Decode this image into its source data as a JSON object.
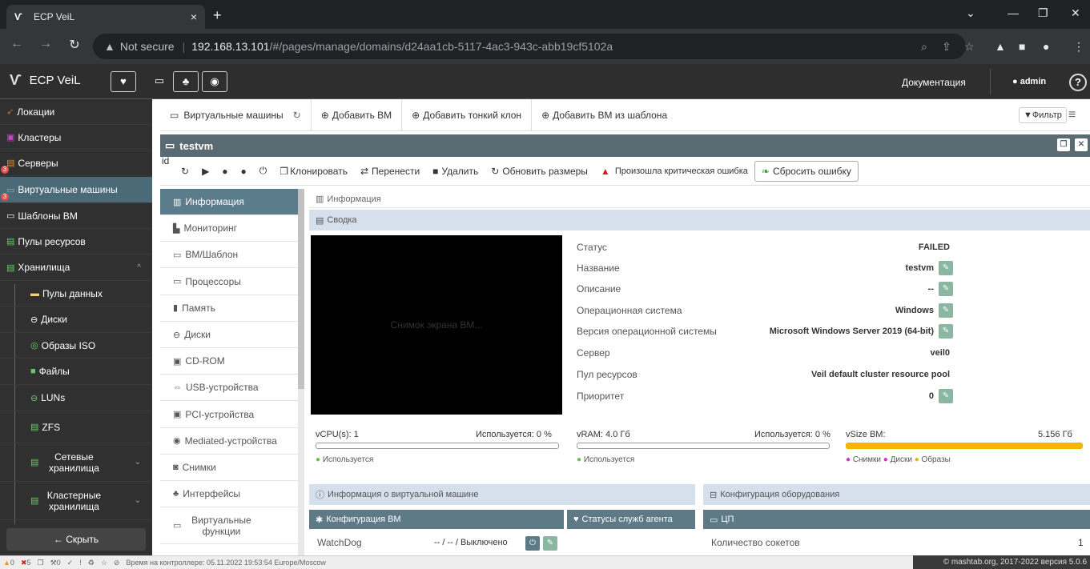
{
  "browser": {
    "tab_title": "ECP VeiL",
    "tab_close": "×",
    "new_tab": "+",
    "url_warning": "Not secure",
    "url_host": "192.168.13.101",
    "url_path": "/#/pages/manage/domains/d24aa1cb-5117-4ac3-943c-abb19cf5102a"
  },
  "header": {
    "brand": "ECP VeiL",
    "docs": "Документация",
    "user": "admin",
    "help": "?"
  },
  "sidebar": {
    "items": [
      {
        "label": "Локации",
        "icon": "location-icon"
      },
      {
        "label": "Кластеры",
        "icon": "cluster-icon"
      },
      {
        "label": "Серверы",
        "icon": "server-icon",
        "badge": "3"
      },
      {
        "label": "Виртуальные машины",
        "icon": "vm-icon",
        "badge": "3"
      },
      {
        "label": "Шаблоны ВМ",
        "icon": "template-icon"
      },
      {
        "label": "Пулы ресурсов",
        "icon": "resource-pool-icon"
      },
      {
        "label": "Хранилища",
        "icon": "storage-icon"
      },
      {
        "label": "Пулы данных",
        "icon": "folder-icon"
      },
      {
        "label": "Диски",
        "icon": "disk-icon"
      },
      {
        "label": "Образы ISO",
        "icon": "iso-icon"
      },
      {
        "label": "Файлы",
        "icon": "file-icon"
      },
      {
        "label": "LUNs",
        "icon": "lun-icon"
      },
      {
        "label": "ZFS",
        "icon": "zfs-icon"
      },
      {
        "label": "Сетевые хранилища",
        "icon": "network-storage-icon"
      },
      {
        "label": "Кластерные хранилища",
        "icon": "cluster-storage-icon"
      }
    ],
    "hide_label": "Скрыть"
  },
  "toolbar": {
    "vms_label": "Виртуальные машины",
    "add_vm": "Добавить ВМ",
    "add_thin_clone": "Добавить тонкий клон",
    "add_from_template": "Добавить ВМ из шаблона",
    "filter": "Фильтр"
  },
  "vm": {
    "name": "testvm",
    "id_tag": "id",
    "actions": {
      "clone": "Клонировать",
      "migrate": "Перенести",
      "delete": "Удалить",
      "update_sizes": "Обновить размеры",
      "critical_error": "Произошла критическая ошибка",
      "reset_error": "Сбросить ошибку"
    }
  },
  "vmnav": {
    "items": [
      "Информация",
      "Мониторинг",
      "ВМ/Шаблон",
      "Процессоры",
      "Память",
      "Диски",
      "CD-ROM",
      "USB-устройства",
      "PCI-устройства",
      "Mediated-устройства",
      "Снимки",
      "Интерфейсы",
      "Виртуальные функции"
    ]
  },
  "content": {
    "breadcrumb": "Информация",
    "summary_title": "Сводка",
    "screenshot_placeholder": "Снимок экрана ВМ...",
    "props": [
      {
        "label": "Статус",
        "value": "FAILED",
        "editable": false
      },
      {
        "label": "Название",
        "value": "testvm",
        "editable": true
      },
      {
        "label": "Описание",
        "value": "--",
        "editable": true
      },
      {
        "label": "Операционная система",
        "value": "Windows",
        "editable": true
      },
      {
        "label": "Версия операционной системы",
        "value": "Microsoft Windows Server 2019 (64-bit)",
        "editable": true
      },
      {
        "label": "Сервер",
        "value": "veil0",
        "editable": false
      },
      {
        "label": "Пул ресурсов",
        "value": "Veil default cluster resource pool",
        "editable": false
      },
      {
        "label": "Приоритет",
        "value": "0",
        "editable": true
      }
    ],
    "meters": {
      "vcpu": {
        "label": "vCPU(s): 1",
        "used": "Используется: 0 %",
        "legend": "Используется",
        "fraction": 0
      },
      "vram": {
        "label": "vRAM: 4.0 Гб",
        "used": "Используется: 0 %",
        "legend": "Используется",
        "fraction": 0
      },
      "vsize": {
        "label": "vSize ВМ:",
        "value": "5.156 Гб",
        "legend_snapshots": "Снимки",
        "legend_disks": "Диски",
        "legend_images": "Образы",
        "fraction": 1
      }
    },
    "vm_info_title": "Информация о виртуальной машине",
    "vm_config_title": "Конфигурация ВМ",
    "agent_status_title": "Статусы служб агента",
    "watchdog_label": "WatchDog",
    "watchdog_value": "-- / -- / Выключено",
    "hw_config_title": "Конфигурация оборудования",
    "cpu_title": "ЦП",
    "sockets_label": "Количество сокетов",
    "sockets_value": "1"
  },
  "statusbar": {
    "warnings": "0",
    "errors": "5",
    "tasks": "0",
    "time_text": "Время на контроллере: 05.11.2022 19:53:54 Europe/Moscow",
    "copyright": "© mashtab.org, 2017-2022 версия 5.0.6"
  },
  "colors": {
    "active_nav": "#5b7c8a",
    "panel_header": "#d6e0ec",
    "critical": "#d42020",
    "vsize_bar": "#f5b400"
  }
}
